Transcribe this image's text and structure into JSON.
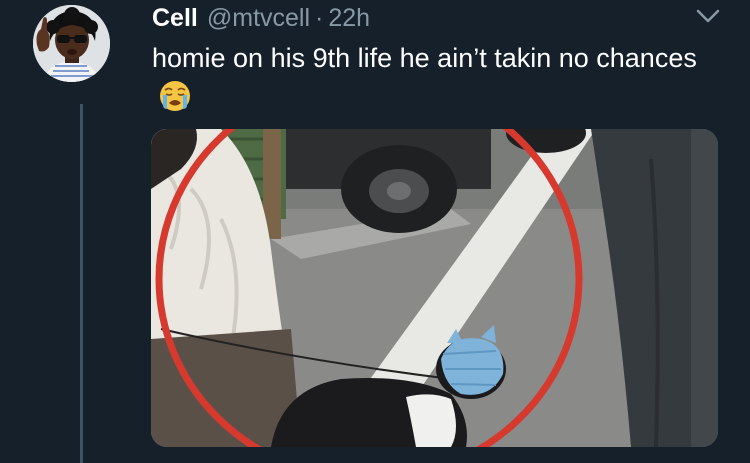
{
  "tweet": {
    "display_name": "Cell",
    "handle": "@mtvcell",
    "separator": "·",
    "timestamp": "22h",
    "text": "homie on his 9th life he ain’t takin no chances",
    "emoji": "crying-face-emoji"
  },
  "icons": {
    "caret": "chevron-down-icon"
  },
  "colors": {
    "background": "#15202b",
    "secondary_text": "#8899a6",
    "thread_line": "#3d5466",
    "circle_highlight": "#d63a2f"
  }
}
